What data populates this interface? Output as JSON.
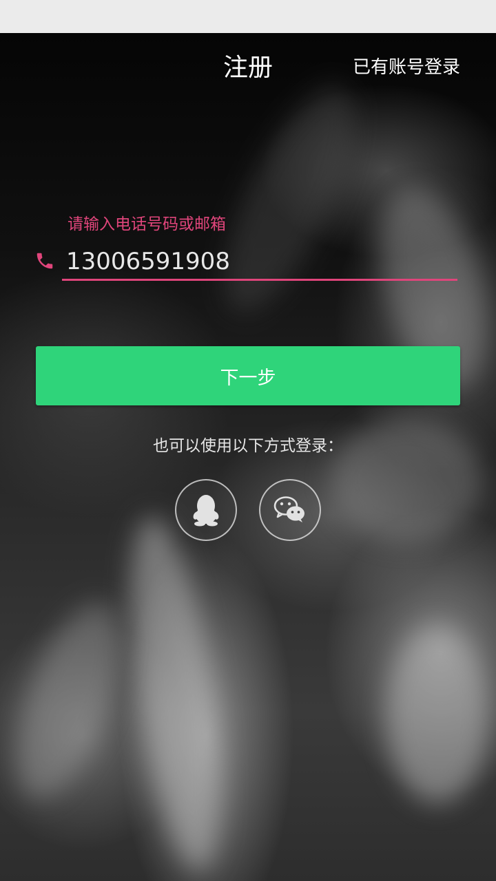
{
  "header": {
    "title": "注册",
    "login_link": "已有账号登录"
  },
  "form": {
    "field_label": "请输入电话号码或邮箱",
    "phone_value": "13006591908",
    "phone_icon": "phone-icon",
    "next_button": "下一步"
  },
  "alternative_login": {
    "label": "也可以使用以下方式登录：",
    "options": [
      {
        "icon": "qq-penguin-icon"
      },
      {
        "icon": "wechat-icon"
      }
    ]
  },
  "colors": {
    "accent": "#e0457b",
    "primary_button": "#2fd47a",
    "text": "#ffffff"
  }
}
